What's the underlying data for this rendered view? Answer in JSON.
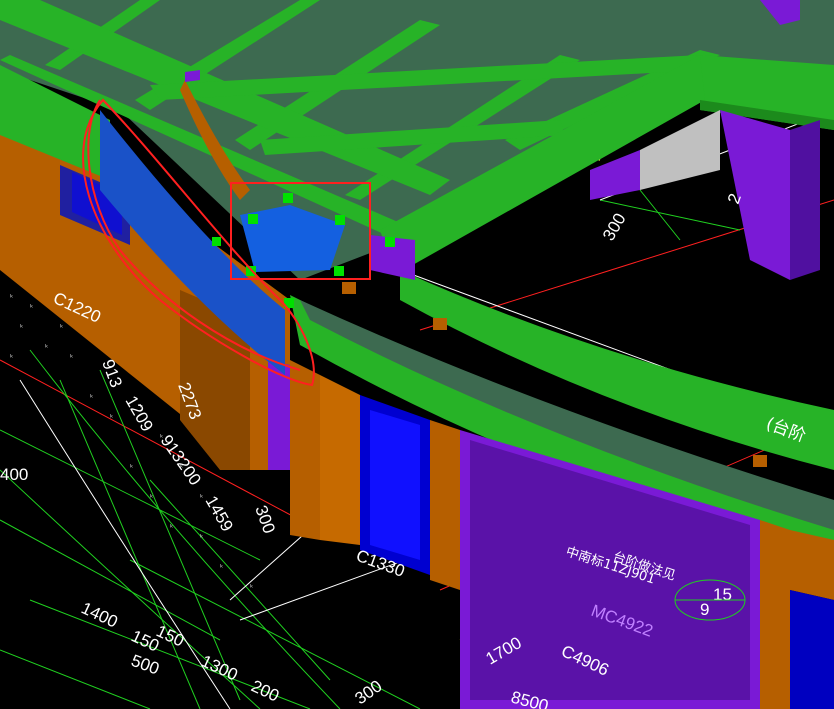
{
  "viewport": {
    "background": "#000000",
    "colors": {
      "beam_green": "#27b327",
      "slab_green": "#3d6a50",
      "column_purple": "#7a1ad6",
      "wall_orange": "#b65f00",
      "selected_beam_blue": "#1a52c8",
      "grip_green": "#00e000",
      "annotation_red": "#ff2020",
      "axis_yellow": "#ffff30",
      "dimension_green": "#20d020"
    },
    "labels": {
      "window_c1220": "C1220",
      "window_c1330": "C1330",
      "door_mc4922": "MC4922",
      "door_c4906": "C4906",
      "dim_300_top": "300",
      "dim_2l": "2",
      "dim_913": "913",
      "dim_1209": "1209",
      "dim_2273": "2273",
      "dim_913200": "913200",
      "dim_1459": "1459",
      "dim_300_mid": "300",
      "dim_400": "400",
      "dim_1400": "1400",
      "dim_150": "150",
      "dim_1500": "150",
      "dim_500": "500",
      "dim_1300": "1300",
      "dim_200": "200",
      "dim_300_low": "300",
      "dim_1700": "1700",
      "dim_8500": "8500",
      "cjk_line1": "台阶做法见",
      "cjk_line2": "中南标11ZJ901",
      "ref_num_top": "15",
      "ref_num_bottom": "9",
      "tag_bracket": "(台阶"
    }
  }
}
